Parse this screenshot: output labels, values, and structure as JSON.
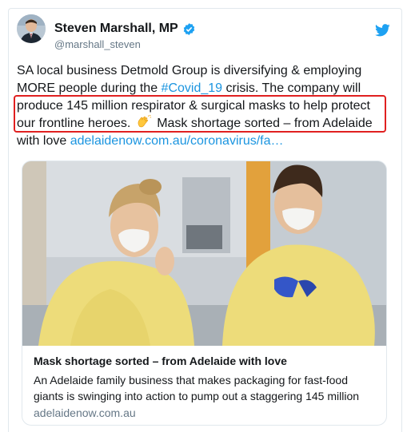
{
  "author": {
    "display_name": "Steven Marshall, MP",
    "handle": "@marshall_steven"
  },
  "icons": {
    "verified": "verified-badge-icon",
    "brand": "twitter-bird-icon",
    "emoji": "clapping-hands-emoji"
  },
  "tweet": {
    "part1": "SA local business Detmold Group is diversifying & employing MORE people during the ",
    "hashtag": "#Covid_19",
    "part2": " crisis. The company will produce 145 million respirator & surgical masks to help protect our frontline heroes. ",
    "part3": " Mask shortage sorted – from Adelaide with love ",
    "link": "adelaidenow.com.au/coronavirus/fa…"
  },
  "link_card": {
    "title": "Mask shortage sorted – from Adelaide with love",
    "description": "An Adelaide family business that makes packaging for fast-food giants is swinging into action to pump out a staggering 145 million",
    "domain": "adelaidenow.com.au"
  },
  "colors": {
    "link": "#1b95e0",
    "twitter_blue": "#1da1f2",
    "highlight_border": "#e02020",
    "muted": "#657786"
  }
}
